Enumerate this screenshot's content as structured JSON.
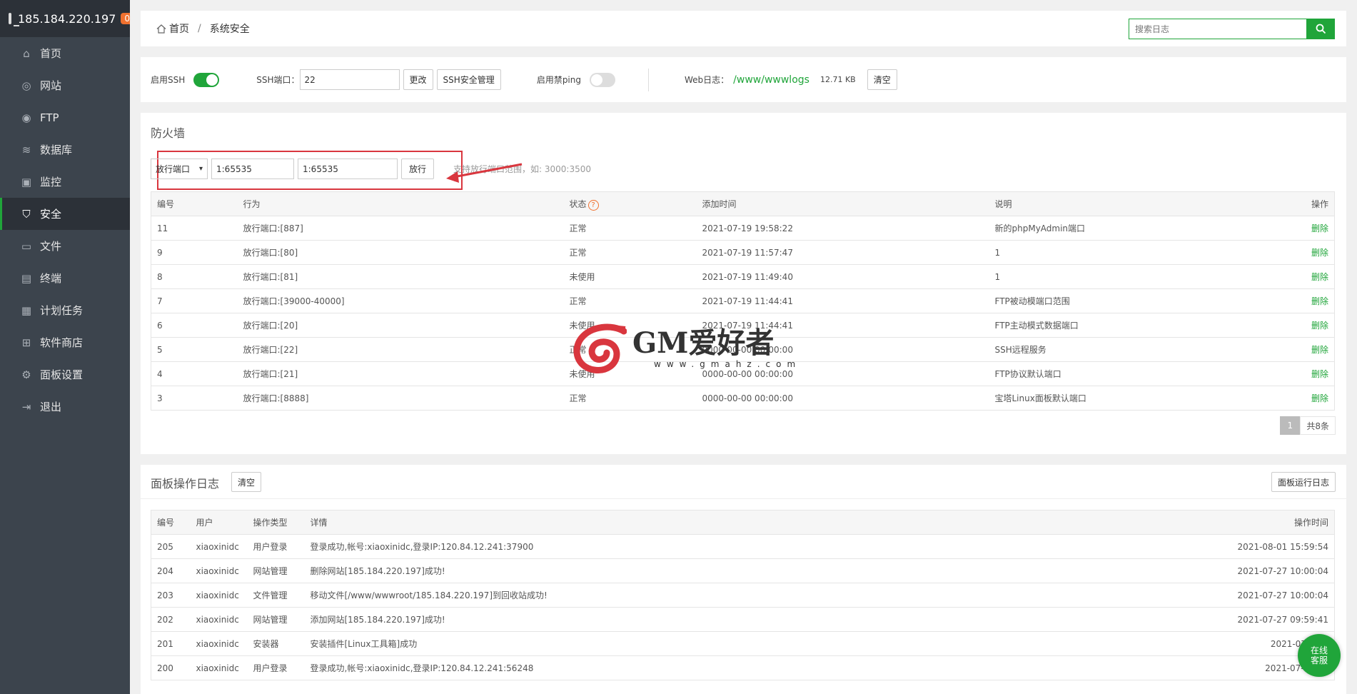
{
  "server": {
    "ip": "185.184.220.197",
    "badge": "0"
  },
  "sidebar": {
    "items": [
      {
        "label": "首页",
        "icon": "home-icon",
        "glyph": "⌂"
      },
      {
        "label": "网站",
        "icon": "globe-icon",
        "glyph": "◎"
      },
      {
        "label": "FTP",
        "icon": "ftp-icon",
        "glyph": "◉"
      },
      {
        "label": "数据库",
        "icon": "database-icon",
        "glyph": "≋"
      },
      {
        "label": "监控",
        "icon": "monitor-icon",
        "glyph": "▣"
      },
      {
        "label": "安全",
        "icon": "shield-icon",
        "glyph": "⛉",
        "active": true
      },
      {
        "label": "文件",
        "icon": "folder-icon",
        "glyph": "▭"
      },
      {
        "label": "终端",
        "icon": "terminal-icon",
        "glyph": "▤"
      },
      {
        "label": "计划任务",
        "icon": "calendar-icon",
        "glyph": "▦"
      },
      {
        "label": "软件商店",
        "icon": "grid-icon",
        "glyph": "⊞"
      },
      {
        "label": "面板设置",
        "icon": "gear-icon",
        "glyph": "⚙"
      },
      {
        "label": "退出",
        "icon": "logout-icon",
        "glyph": "⇥"
      }
    ]
  },
  "breadcrumb": {
    "home": "首页",
    "sep": "/",
    "current": "系统安全"
  },
  "search": {
    "placeholder": "搜索日志"
  },
  "ssh": {
    "enable_label": "启用SSH",
    "port_label": "SSH端口：",
    "port_value": "22",
    "change_btn": "更改",
    "manage_btn": "SSH安全管理",
    "ping_label": "启用禁ping",
    "weblog_label": "Web日志：",
    "weblog_path": "/www/wwwlogs",
    "weblog_size": "12.71 KB",
    "clear_btn": "清空"
  },
  "firewall": {
    "title": "防火墙",
    "select_value": "放行端口",
    "port_from": "1:65535",
    "port_to": "1:65535",
    "add_btn": "放行",
    "hint": "支持放行端口范围，如: 3000:3500",
    "columns": [
      "编号",
      "行为",
      "状态",
      "添加时间",
      "说明",
      "操作"
    ],
    "rows": [
      {
        "id": "11",
        "action": "放行端口:[887]",
        "status": "正常",
        "time": "2021-07-19 19:58:22",
        "note": "新的phpMyAdmin端口",
        "op": "删除"
      },
      {
        "id": "9",
        "action": "放行端口:[80]",
        "status": "正常",
        "time": "2021-07-19 11:57:47",
        "note": "1",
        "op": "删除"
      },
      {
        "id": "8",
        "action": "放行端口:[81]",
        "status": "未使用",
        "time": "2021-07-19 11:49:40",
        "note": "1",
        "op": "删除"
      },
      {
        "id": "7",
        "action": "放行端口:[39000-40000]",
        "status": "正常",
        "time": "2021-07-19 11:44:41",
        "note": "FTP被动模端口范围",
        "op": "删除"
      },
      {
        "id": "6",
        "action": "放行端口:[20]",
        "status": "未使用",
        "time": "2021-07-19 11:44:41",
        "note": "FTP主动模式数据端口",
        "op": "删除"
      },
      {
        "id": "5",
        "action": "放行端口:[22]",
        "status": "正常",
        "time": "0000-00-00 00:00:00",
        "note": "SSH远程服务",
        "op": "删除"
      },
      {
        "id": "4",
        "action": "放行端口:[21]",
        "status": "未使用",
        "time": "0000-00-00 00:00:00",
        "note": "FTP协议默认端口",
        "op": "删除"
      },
      {
        "id": "3",
        "action": "放行端口:[8888]",
        "status": "正常",
        "time": "0000-00-00 00:00:00",
        "note": "宝塔Linux面板默认端口",
        "op": "删除"
      }
    ],
    "pager": {
      "page": "1",
      "total": "共8条"
    }
  },
  "panel_log": {
    "title": "面板操作日志",
    "clear_btn": "清空",
    "run_log_btn": "面板运行日志",
    "columns": [
      "编号",
      "用户",
      "操作类型",
      "详情",
      "操作时间"
    ],
    "rows": [
      {
        "id": "205",
        "user": "xiaoxinidc",
        "type": "用户登录",
        "detail": "登录成功,帐号:xiaoxinidc,登录IP:120.84.12.241:37900",
        "time": "2021-08-01 15:59:54"
      },
      {
        "id": "204",
        "user": "xiaoxinidc",
        "type": "网站管理",
        "detail": "删除网站[185.184.220.197]成功!",
        "time": "2021-07-27 10:00:04"
      },
      {
        "id": "203",
        "user": "xiaoxinidc",
        "type": "文件管理",
        "detail": "移动文件[/www/wwwroot/185.184.220.197]到回收站成功!",
        "time": "2021-07-27 10:00:04"
      },
      {
        "id": "202",
        "user": "xiaoxinidc",
        "type": "网站管理",
        "detail": "添加网站[185.184.220.197]成功!",
        "time": "2021-07-27 09:59:41"
      },
      {
        "id": "201",
        "user": "xiaoxinidc",
        "type": "安装器",
        "detail": "安装插件[Linux工具箱]成功",
        "time": "2021-07-27 0"
      },
      {
        "id": "200",
        "user": "xiaoxinidc",
        "type": "用户登录",
        "detail": "登录成功,帐号:xiaoxinidc,登录IP:120.84.12.241:56248",
        "time": "2021-07-22 18"
      }
    ]
  },
  "watermark": {
    "title": "GM爱好者",
    "url": "www.gmahz.com"
  },
  "chat": {
    "line1": "在线",
    "line2": "客服"
  },
  "colors": {
    "accent": "#20a53a",
    "sidebar": "#3c444d",
    "sidebar_dark": "#2c3138",
    "badge": "#f0712f",
    "highlight": "#d9363e"
  }
}
